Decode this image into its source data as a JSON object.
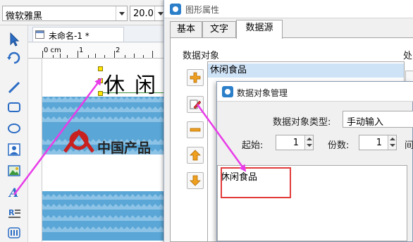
{
  "toolbar": {
    "font_name": "微软雅黑",
    "font_size": "20.0"
  },
  "document": {
    "tab_label": "未命名-1 *",
    "ruler_labels": [
      "0 cm",
      "1",
      "2"
    ],
    "text_object": "休闲",
    "brand_text": "中国产品"
  },
  "properties_dialog": {
    "title": "图形属性",
    "tabs": [
      "基本",
      "文字",
      "数据源"
    ],
    "active_tab": "数据源",
    "data_objects_label": "数据对象",
    "processing_label_partial": "处",
    "data_objects": [
      "休闲食品"
    ],
    "side_buttons": [
      "add-icon",
      "edit-icon",
      "remove-icon",
      "move-up-icon",
      "move-down-icon"
    ]
  },
  "manager_dialog": {
    "title": "数据对象管理",
    "type_label": "数据对象类型:",
    "type_value": "手动输入",
    "start_label": "起始:",
    "start_value": "1",
    "copies_label": "份数:",
    "copies_value": "1",
    "interval_label_partial": "间",
    "content": "休闲食品"
  },
  "colors": {
    "accent_arrow": "#e83ce8",
    "highlight": "#e23b3b",
    "band": "#5aa6d6",
    "selection": "#cfe3f7"
  }
}
